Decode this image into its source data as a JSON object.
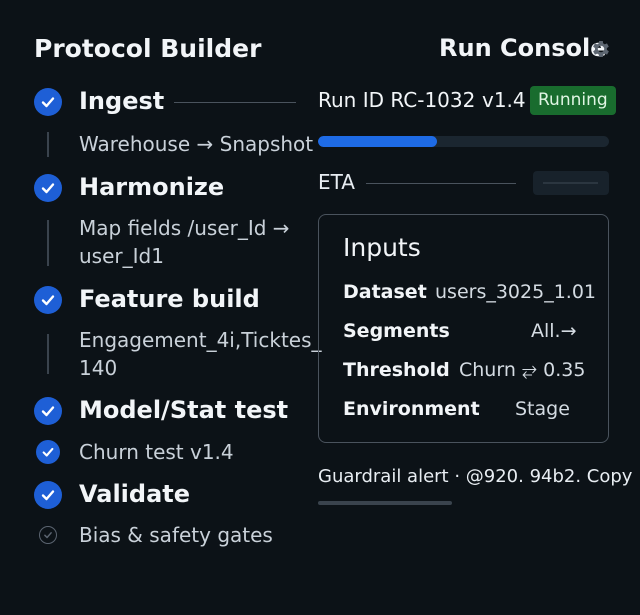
{
  "builder": {
    "title": "Protocol Builder",
    "steps": [
      {
        "label": "Ingest",
        "detail": "Warehouse → Snapshot"
      },
      {
        "label": "Harmonize",
        "detail_line1": "Map fields /user_Id →",
        "detail_line2": "user_Id1"
      },
      {
        "label": "Feature build",
        "detail_line1": "Engagement_4i,Ticktes_",
        "detail_line2": "140"
      },
      {
        "label": "Model/Stat test",
        "detail": "Churn test v1.4"
      },
      {
        "label": "Validate",
        "detail": "Bias & safety gates"
      }
    ]
  },
  "console": {
    "title": "Run Console",
    "run_id": "Run ID RC-1032",
    "version": "v1.4",
    "status": "Running",
    "progress": 0.41,
    "eta_label": "ETA",
    "inputs": {
      "title": "Inputs",
      "rows": [
        {
          "key": "Dataset",
          "value": "users_3025_1.01"
        },
        {
          "key": "Segments",
          "value": "All.→"
        },
        {
          "key": "Threshold",
          "value": "Churn ⥂ 0.35"
        },
        {
          "key": "Environment",
          "value": "Stage"
        }
      ]
    },
    "guardrail": "Guardrail alert · @920. 94b2. Copy"
  },
  "colors": {
    "background": "#0c1217",
    "accent": "#1e6be6",
    "status_green": "#196c2e"
  }
}
